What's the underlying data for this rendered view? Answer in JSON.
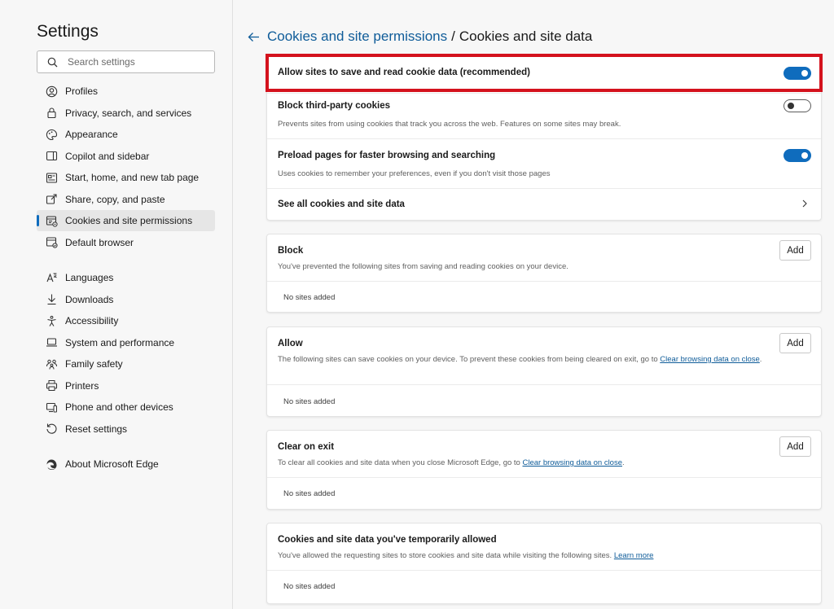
{
  "sidebar": {
    "title": "Settings",
    "search_placeholder": "Search settings",
    "items": [
      {
        "label": "Profiles",
        "icon": "profile-icon"
      },
      {
        "label": "Privacy, search, and services",
        "icon": "lock-icon"
      },
      {
        "label": "Appearance",
        "icon": "palette-icon"
      },
      {
        "label": "Copilot and sidebar",
        "icon": "sidebar-icon"
      },
      {
        "label": "Start, home, and new tab page",
        "icon": "home-icon"
      },
      {
        "label": "Share, copy, and paste",
        "icon": "share-icon"
      },
      {
        "label": "Cookies and site permissions",
        "icon": "cookie-permissions-icon",
        "active": true
      },
      {
        "label": "Default browser",
        "icon": "browser-icon"
      },
      {
        "label": "Languages",
        "icon": "languages-icon"
      },
      {
        "label": "Downloads",
        "icon": "download-icon"
      },
      {
        "label": "Accessibility",
        "icon": "accessibility-icon"
      },
      {
        "label": "System and performance",
        "icon": "laptop-icon"
      },
      {
        "label": "Family safety",
        "icon": "family-icon"
      },
      {
        "label": "Printers",
        "icon": "printer-icon"
      },
      {
        "label": "Phone and other devices",
        "icon": "phone-icon"
      },
      {
        "label": "Reset settings",
        "icon": "reset-icon"
      },
      {
        "label": "About Microsoft Edge",
        "icon": "edge-logo-icon"
      }
    ]
  },
  "header": {
    "parent": "Cookies and site permissions",
    "separator": "/",
    "current": "Cookies and site data"
  },
  "cookie_settings": {
    "allow": {
      "label": "Allow sites to save and read cookie data (recommended)",
      "enabled": true
    },
    "block_third_party": {
      "label": "Block third-party cookies",
      "description": "Prevents sites from using cookies that track you across the web. Features on some sites may break.",
      "enabled": false
    },
    "preload": {
      "label": "Preload pages for faster browsing and searching",
      "description": "Uses cookies to remember your preferences, even if you don't visit those pages",
      "enabled": true
    },
    "see_all": {
      "label": "See all cookies and site data"
    }
  },
  "block_section": {
    "title": "Block",
    "description": "You've prevented the following sites from saving and reading cookies on your device.",
    "add_label": "Add",
    "empty": "No sites added"
  },
  "allow_section": {
    "title": "Allow",
    "description": "The following sites can save cookies on your device. To prevent these cookies from being cleared on exit, go to ",
    "link": "Clear browsing data on close",
    "suffix": ".",
    "add_label": "Add",
    "empty": "No sites added"
  },
  "clear_section": {
    "title": "Clear on exit",
    "description": "To clear all cookies and site data when you close Microsoft Edge, go to ",
    "link": "Clear browsing data on close",
    "suffix": ".",
    "add_label": "Add",
    "empty": "No sites added"
  },
  "temp_section": {
    "title": "Cookies and site data you've temporarily allowed",
    "description": "You've allowed the requesting sites to store cookies and site data while visiting the following sites. ",
    "link": "Learn more",
    "empty": "No sites added"
  },
  "colors": {
    "accent": "#0f6cbd",
    "link": "#0f5c99",
    "highlight": "#d4121d"
  }
}
